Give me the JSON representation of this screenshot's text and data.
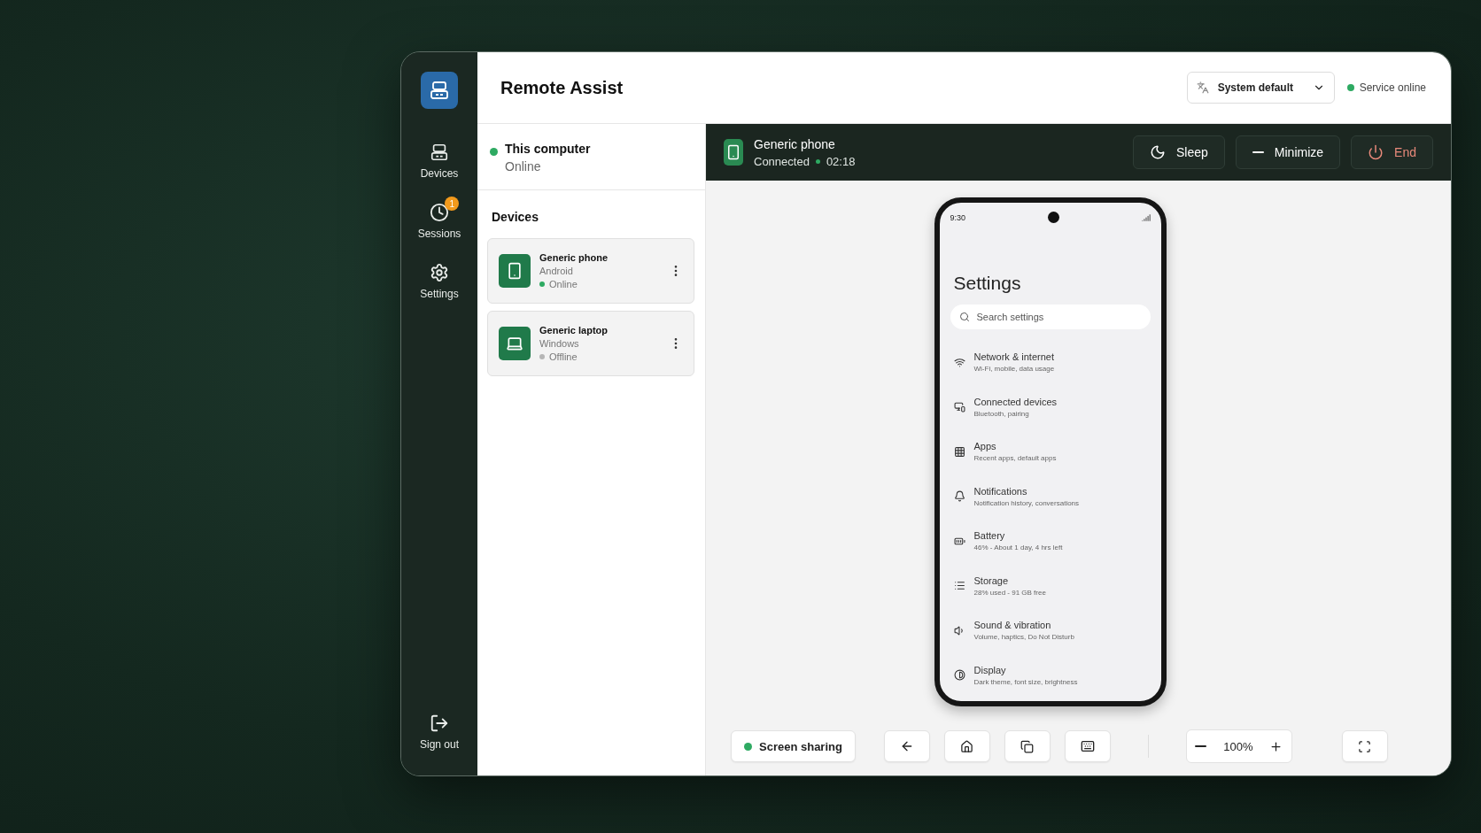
{
  "app": {
    "title": "Remote Assist"
  },
  "rail": {
    "items": [
      {
        "label": "Devices",
        "kind": "devices"
      },
      {
        "label": "Sessions",
        "kind": "sessions",
        "badge": "1"
      },
      {
        "label": "Settings",
        "kind": "settings"
      }
    ],
    "sign_out": "Sign out"
  },
  "language_select": {
    "value": "System default"
  },
  "service_status": {
    "label": "Service online",
    "online": true
  },
  "this_computer": {
    "title": "This computer",
    "status": "Online",
    "online": true
  },
  "devices": {
    "heading": "Devices",
    "items": [
      {
        "name": "Generic phone",
        "os": "Android",
        "status": "Online",
        "online": true,
        "kind": "phone"
      },
      {
        "name": "Generic laptop",
        "os": "Windows",
        "status": "Offline",
        "online": false,
        "kind": "laptop"
      }
    ]
  },
  "session": {
    "device": "Generic phone",
    "status": "Connected",
    "time": "02:18",
    "actions": [
      {
        "label": "Sleep",
        "kind": "sleep"
      },
      {
        "label": "Minimize",
        "kind": "minimize"
      },
      {
        "label": "End",
        "kind": "end"
      }
    ]
  },
  "phone_screen": {
    "time": "9:30",
    "title": "Settings",
    "search_placeholder": "Search settings",
    "items": [
      {
        "title": "Network & internet",
        "subtitle": "Wi-Fi, mobile, data usage",
        "kind": "network"
      },
      {
        "title": "Connected devices",
        "subtitle": "Bluetooth, pairing",
        "kind": "devices"
      },
      {
        "title": "Apps",
        "subtitle": "Recent apps, default apps",
        "kind": "apps"
      },
      {
        "title": "Notifications",
        "subtitle": "Notification history, conversations",
        "kind": "notifications"
      },
      {
        "title": "Battery",
        "subtitle": "46% - About 1 day, 4 hrs left",
        "kind": "battery"
      },
      {
        "title": "Storage",
        "subtitle": "28% used - 91 GB free",
        "kind": "storage"
      },
      {
        "title": "Sound & vibration",
        "subtitle": "Volume, haptics, Do Not Disturb",
        "kind": "sound"
      },
      {
        "title": "Display",
        "subtitle": "Dark theme, font size, brightness",
        "kind": "display"
      }
    ]
  },
  "toolbar": {
    "sharing": {
      "label": "Screen sharing",
      "on": true
    },
    "zoom": "100%"
  }
}
